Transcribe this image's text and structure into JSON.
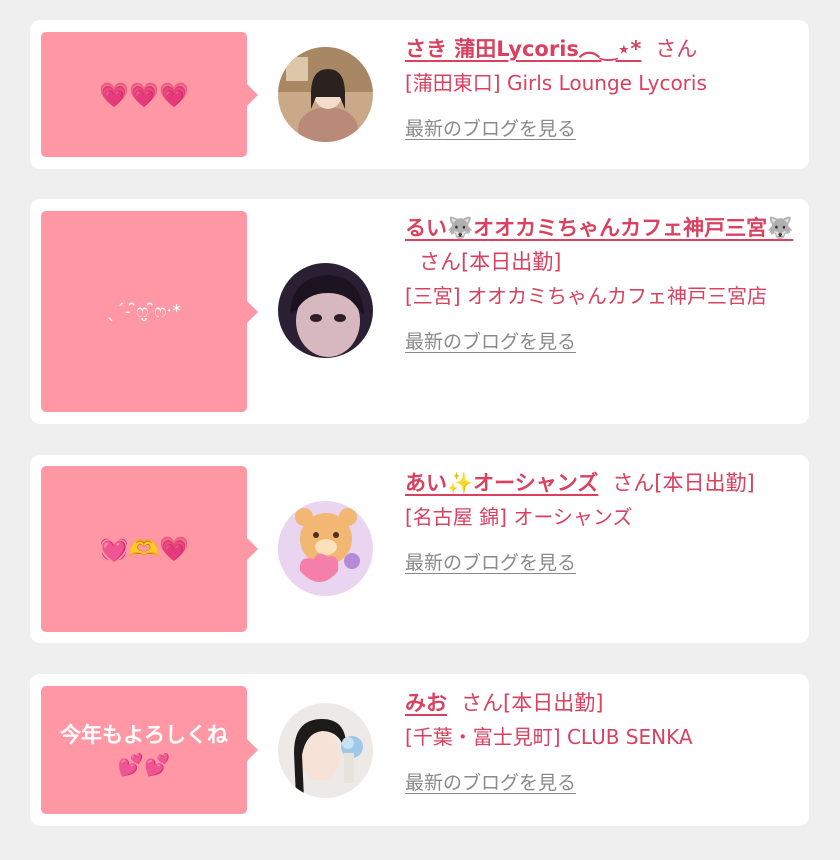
{
  "cards": [
    {
      "message": "💗💗💗",
      "name": "さき 蒲田Lycoris︵‿⋆*",
      "suffix": "さん",
      "shop": "[蒲田東口] Girls Lounge Lycoris",
      "blog_link": "最新のブログを見る"
    },
    {
      "message": "ˎˊ˗ ̑̑ෆ̤̮ ̑̑ෆ‧*",
      "name": "るい🐺オオカミちゃんカフェ神戸三宮🐺",
      "suffix": "さん[本日出勤]",
      "shop": "[三宮] オオカミちゃんカフェ神戸三宮店",
      "blog_link": "最新のブログを見る"
    },
    {
      "message": "💓🫶💗",
      "name": "あい✨オーシャンズ",
      "suffix": "さん[本日出勤]",
      "shop": "[名古屋 錦] オーシャンズ",
      "blog_link": "最新のブログを見る"
    },
    {
      "message": "今年もよろしくね\n💕💕",
      "name": "みお",
      "suffix": "さん[本日出勤]",
      "shop": "[千葉・富士見町] CLUB SENKA",
      "blog_link": "最新のブログを見る"
    }
  ],
  "colors": {
    "accent": "#d9415f",
    "bubble": "#ff98a4",
    "background": "#efefef",
    "card": "#ffffff",
    "link_gray": "#8a8a8a"
  }
}
